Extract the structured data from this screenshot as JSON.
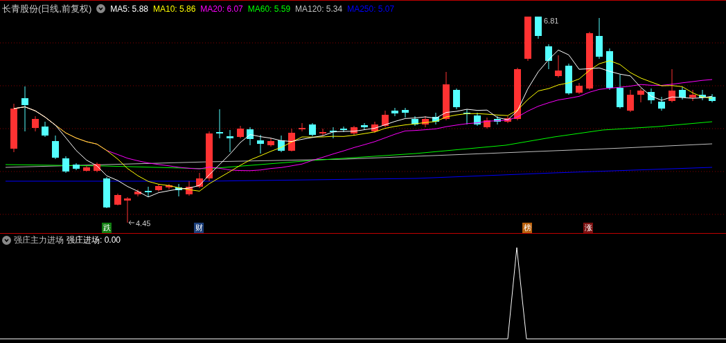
{
  "main_chart": {
    "title": "长青股份(日线,前复权)",
    "moving_averages": [
      {
        "text": "MA5: 5.88",
        "color": "#ffffff"
      },
      {
        "text": "MA10: 5.86",
        "color": "#ffff00"
      },
      {
        "text": "MA20: 6.07",
        "color": "#ff00ff"
      },
      {
        "text": "MA60: 5.59",
        "color": "#00ff00"
      },
      {
        "text": "MA120: 5.34",
        "color": "#c0c0c0"
      },
      {
        "text": "MA250: 5.07",
        "color": "#0000ff"
      }
    ],
    "high_label": "6.81",
    "low_label": "4.45",
    "events": [
      {
        "text": "跌",
        "color": "#107c10"
      },
      {
        "text": "财",
        "color": "#1c3f7a"
      },
      {
        "text": "榜",
        "color": "#b8600c"
      },
      {
        "text": "涨",
        "color": "#7a1010"
      }
    ]
  },
  "indicator": {
    "title": "强庄主力进场",
    "reading": "强庄进场: 0.00"
  }
}
